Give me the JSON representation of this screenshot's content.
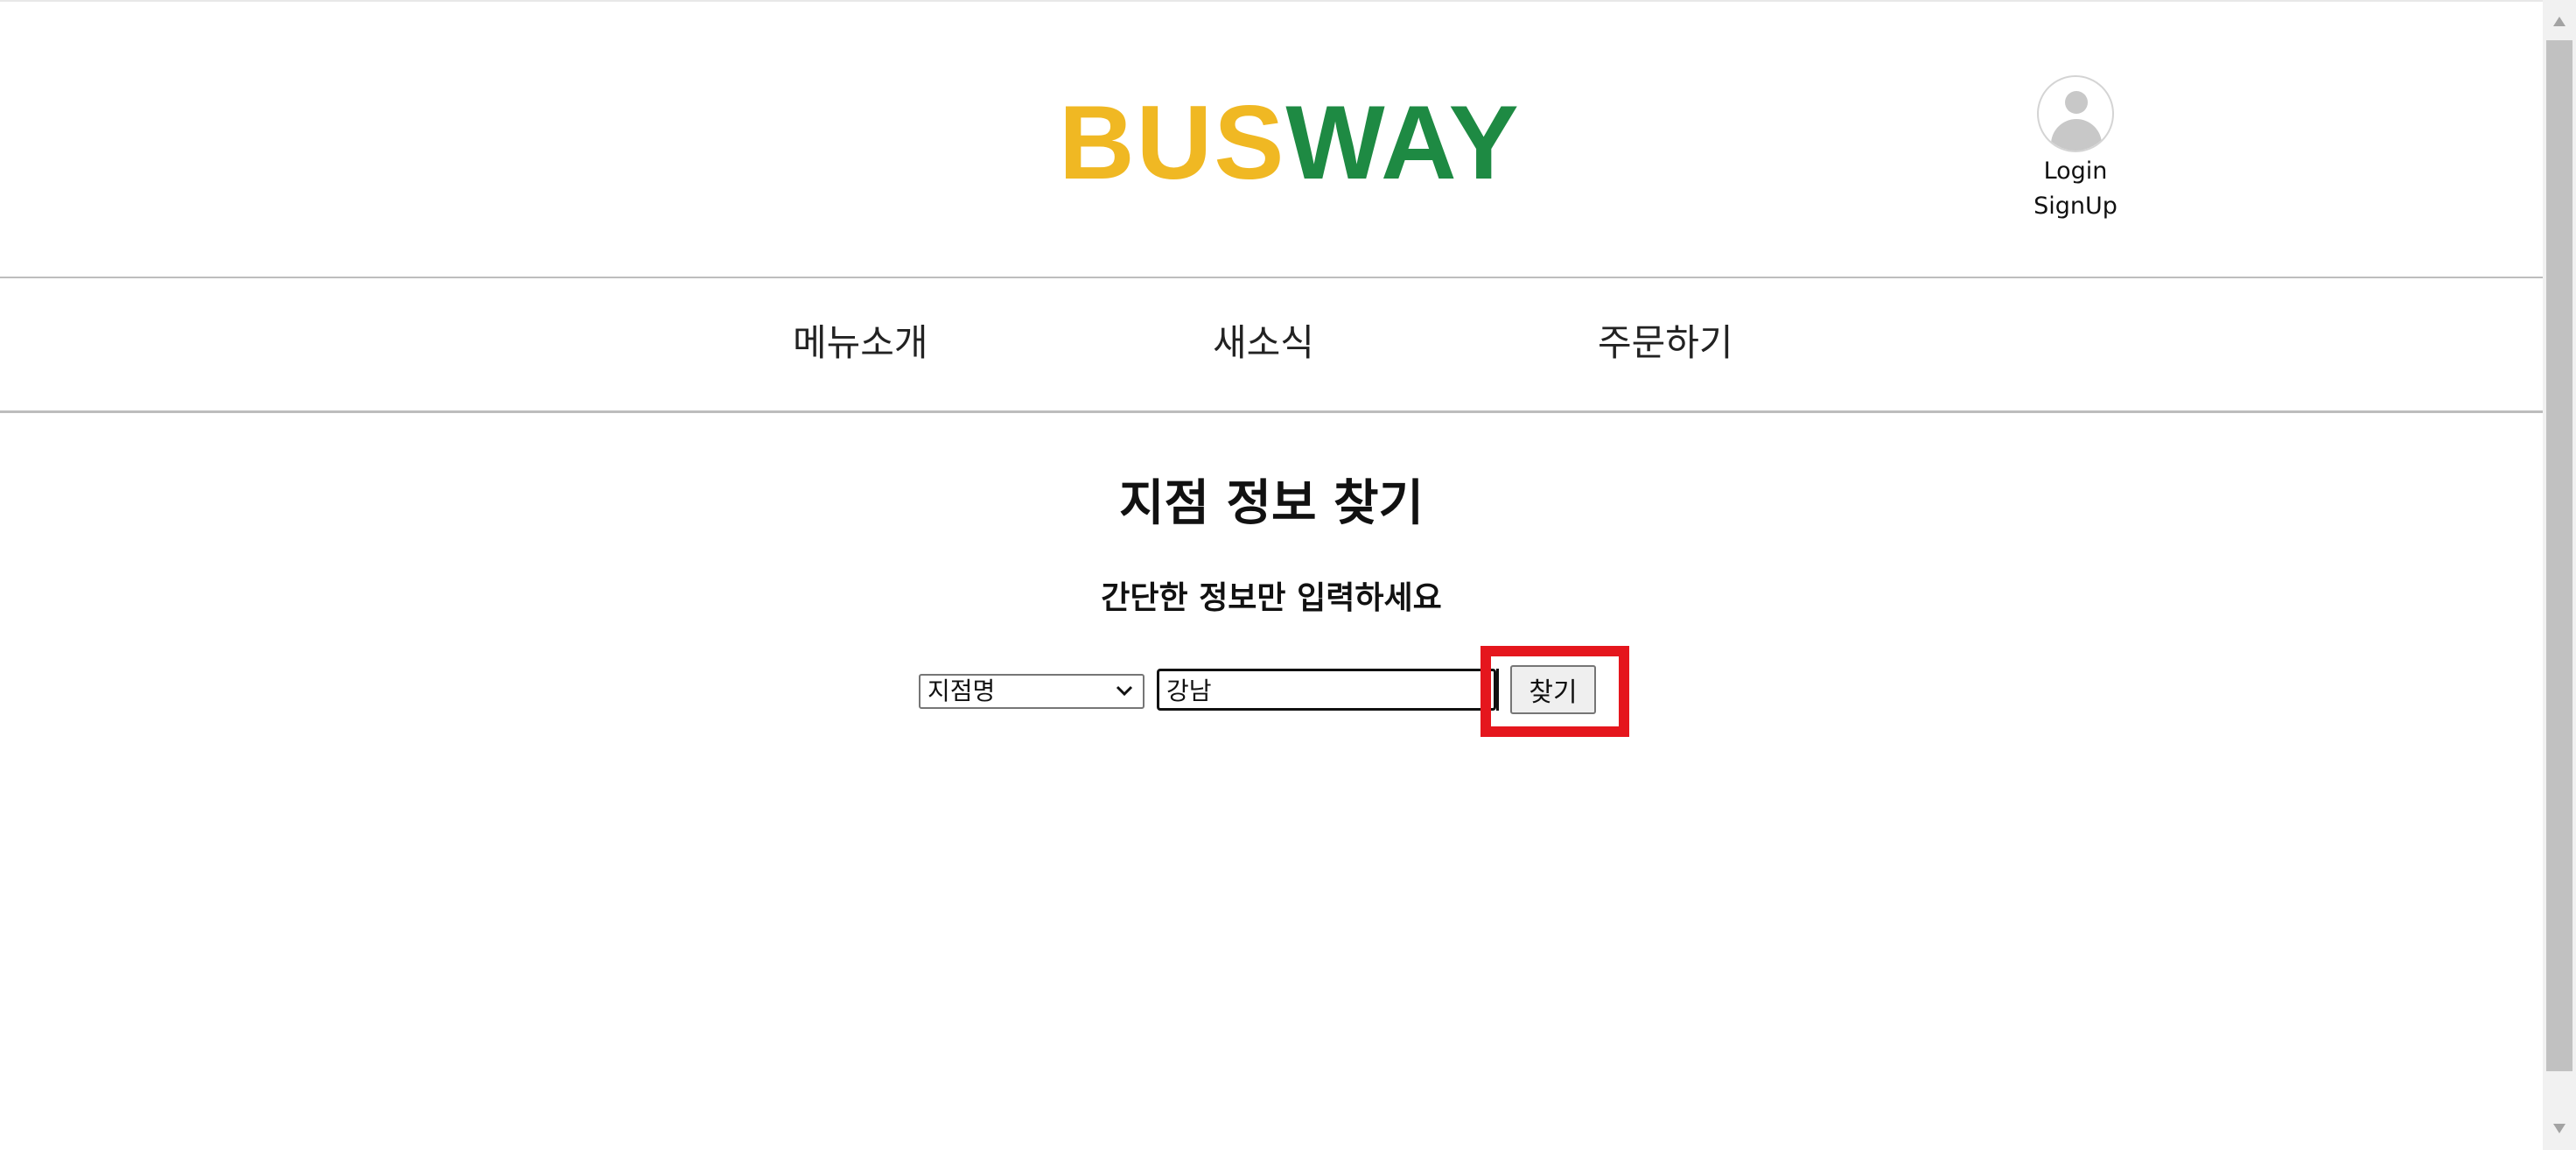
{
  "header": {
    "logo": {
      "part1": "BUS",
      "part2": "WAY",
      "part1_color": "#f0b823",
      "part2_color": "#1e8a43"
    },
    "user": {
      "avatar_icon": "user-avatar-icon",
      "login_label": "Login",
      "signup_label": "SignUp"
    }
  },
  "nav": {
    "items": [
      {
        "label": "메뉴소개"
      },
      {
        "label": "새소식"
      },
      {
        "label": "주문하기"
      }
    ]
  },
  "main": {
    "title": "지점 정보 찾기",
    "subtitle": "간단한 정보만 입력하세요",
    "search": {
      "select_value": "지점명",
      "input_value": "강남",
      "button_label": "찾기",
      "highlight_color": "#e5161d"
    }
  },
  "scrollbar": {
    "up_icon": "arrow-up-icon",
    "down_icon": "arrow-down-icon"
  }
}
